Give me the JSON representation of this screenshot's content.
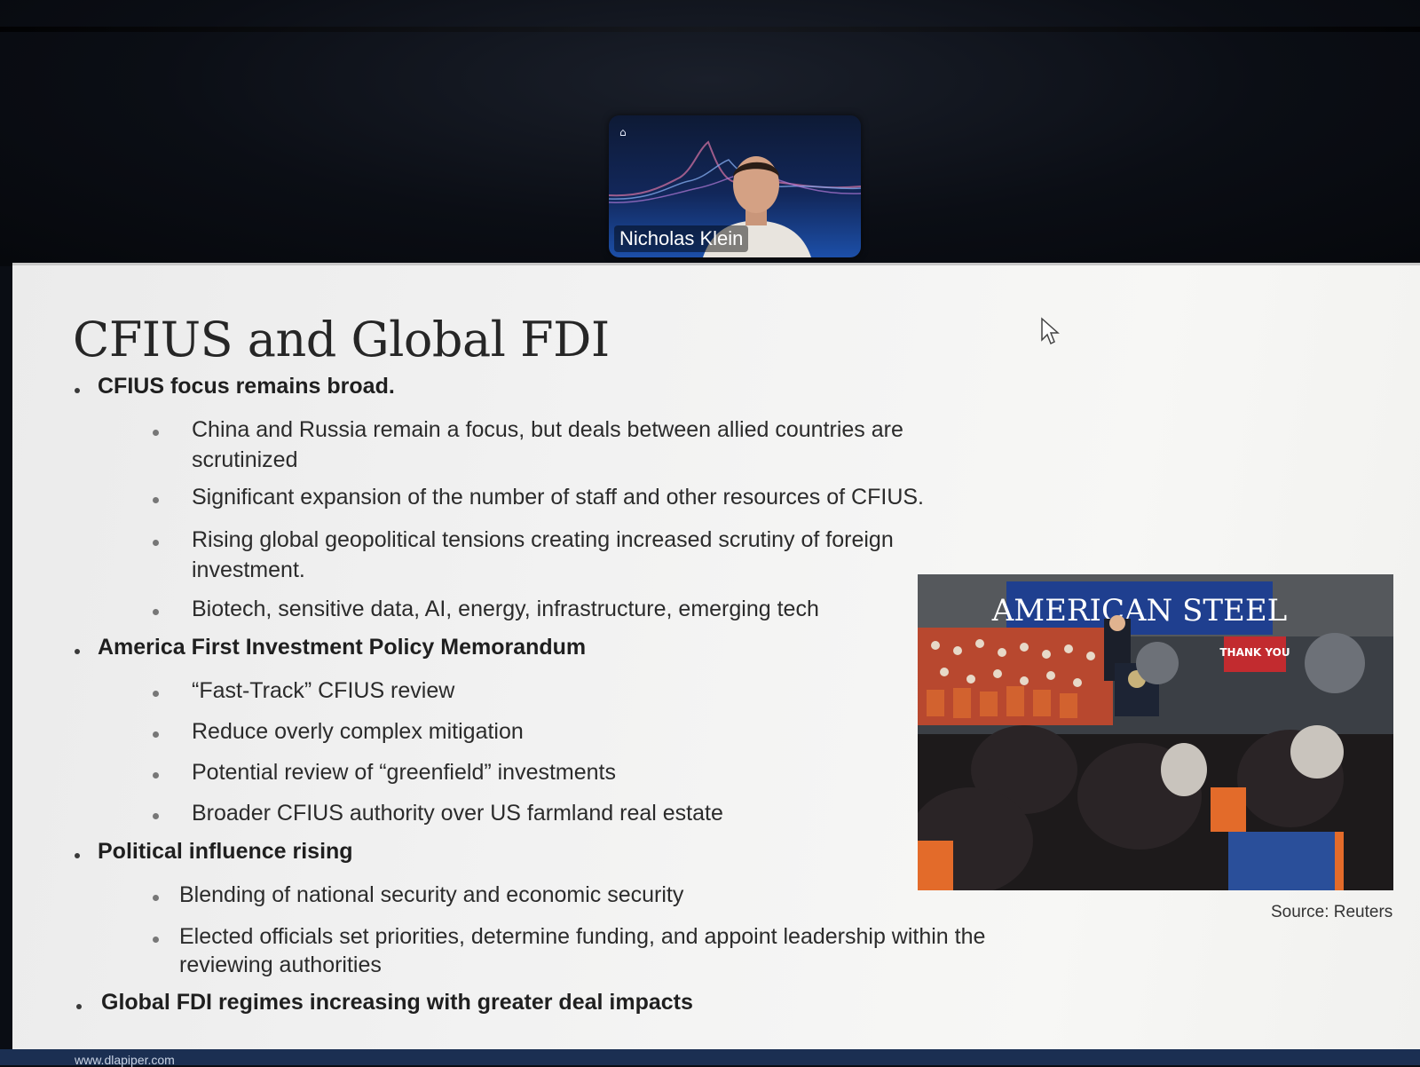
{
  "video": {
    "participant_name": "Nicholas Klein",
    "tile_accent": "#1c4fa8"
  },
  "slide": {
    "title": "CFIUS and Global FDI",
    "sections": [
      {
        "heading": "CFIUS focus remains broad.",
        "items": [
          "China and Russia remain a focus, but deals between allied countries are",
          "scrutinized",
          "Significant expansion of the number of staff and other resources of CFIUS.",
          "Rising global geopolitical tensions creating increased scrutiny of foreign",
          "investment.",
          "Biotech, sensitive data, AI, energy, infrastructure, emerging tech"
        ]
      },
      {
        "heading": "America First Investment Policy Memorandum",
        "items": [
          "“Fast-Track” CFIUS review",
          "Reduce overly complex mitigation",
          "Potential review of “greenfield” investments",
          "Broader CFIUS authority over US farmland real estate"
        ]
      },
      {
        "heading": "Political influence rising",
        "items": [
          "Blending of national security and economic security",
          "Elected officials set priorities, determine funding, and appoint leadership within the",
          "reviewing authorities"
        ]
      },
      {
        "heading": "Global FDI regimes increasing with greater deal impacts",
        "items": []
      }
    ],
    "photo": {
      "banner_text": "AMERICAN STEEL",
      "sign_text": "THANK YOU",
      "caption": "Source: Reuters"
    },
    "footer_url": "www.dlapiper.com"
  },
  "colors": {
    "slide_bg": "#f2f2f2",
    "title": "#262626",
    "footer": "#1b2f52"
  }
}
